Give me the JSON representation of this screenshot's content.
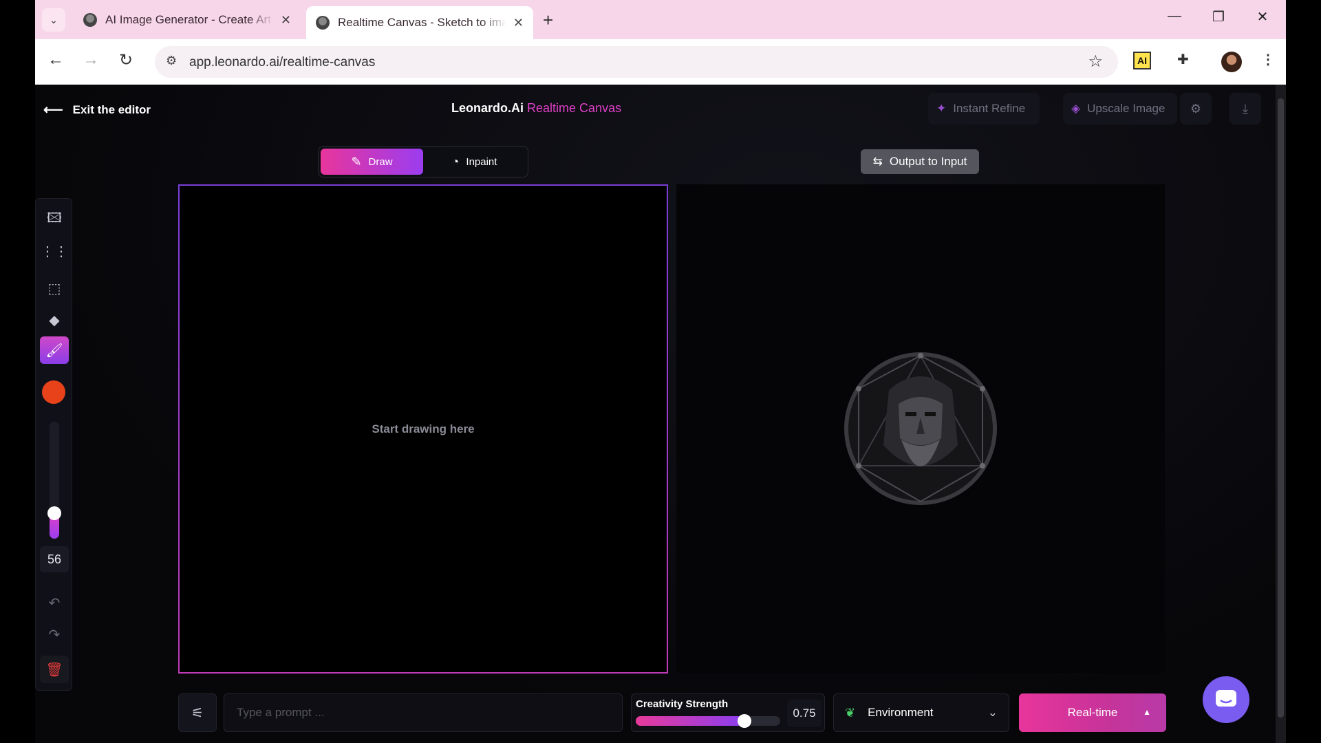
{
  "browser": {
    "tabs": [
      {
        "title": "AI Image Generator - Create Art",
        "active": false
      },
      {
        "title": "Realtime Canvas - Sketch to image",
        "active": true
      }
    ],
    "new_tab_label": "+",
    "url": "app.leonardo.ai/realtime-canvas",
    "ext_ai_label": "AI"
  },
  "app": {
    "exit_label": "Exit the editor",
    "brand_name": "Leonardo.Ai",
    "brand_product": "Realtime Canvas",
    "instant_refine_label": "Instant Refine",
    "upscale_label": "Upscale Image",
    "modes": [
      {
        "label": "Draw",
        "active": true
      },
      {
        "label": "Inpaint",
        "active": false
      }
    ],
    "output_to_input_label": "Output to Input",
    "canvas_hint": "Start drawing here",
    "brush": {
      "color": "#e8421a",
      "size": "56",
      "size_fraction": 0.22
    },
    "prompt_placeholder": "Type a prompt ...",
    "creativity": {
      "label": "Creativity Strength",
      "value": "0.75",
      "fraction": 0.75
    },
    "style_value": "Environment",
    "generate_label": "Real-time"
  },
  "colors": {
    "accent_pink": "#e8359b",
    "accent_purple": "#9b3df0",
    "chat": "#7b5cf0"
  }
}
